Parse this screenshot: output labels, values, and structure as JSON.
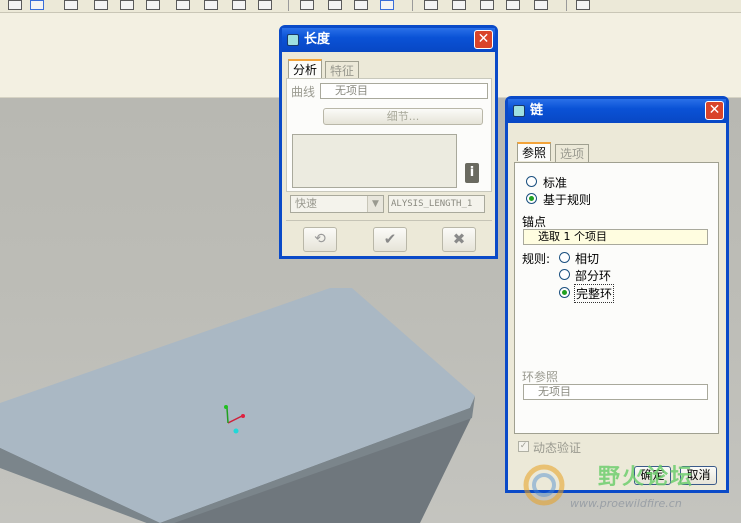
{
  "length_dialog": {
    "title": "长度",
    "tabs": [
      "分析",
      "特征"
    ],
    "curve_label": "曲线",
    "curve_value": "无项目",
    "details_button": "细节...",
    "mode_select": "快速",
    "analysis_name": "ALYSIS_LENGTH_1",
    "info_icon": "i"
  },
  "chain_dialog": {
    "title": "链",
    "tabs": [
      "参照",
      "选项"
    ],
    "type_options": [
      "标准",
      "基于规则"
    ],
    "anchor_label": "锚点",
    "anchor_value": "选取 1 个项目",
    "rules_label": "规则:",
    "rule_options": [
      "相切",
      "部分环",
      "完整环"
    ],
    "loop_ref_label": "环参照",
    "loop_ref_value": "无项目",
    "dynamic_check": "动态验证",
    "ok_button": "确定",
    "cancel_button": "取消"
  },
  "watermark": {
    "text": "野火论坛",
    "url": "www.proewildfire.cn"
  },
  "colors": {
    "title_bar": "#0a52d6",
    "dialog_face": "#ece9d8",
    "model_top": "#aab8c4",
    "model_side": "#6f777d",
    "radio_selected": "#21a121"
  }
}
